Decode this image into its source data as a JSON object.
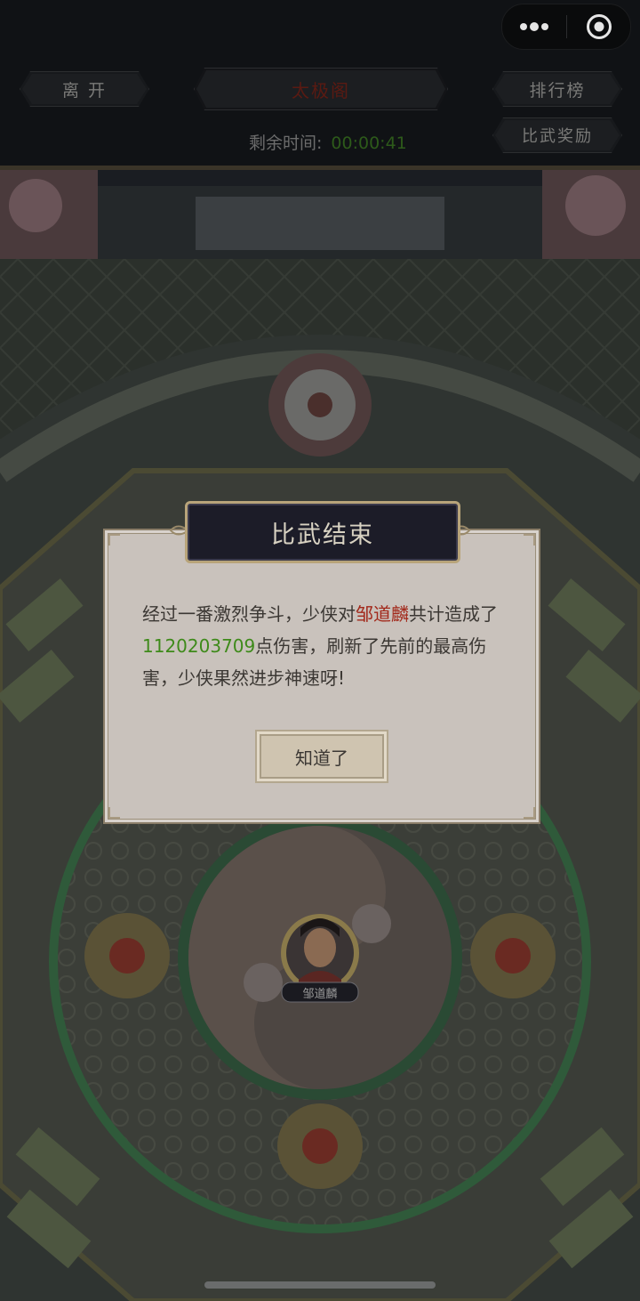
{
  "top_bar": {
    "leave_label": "离 开",
    "arena_title": "太极阁",
    "ranking_label": "排行榜",
    "reward_label": "比武奖励",
    "timer_label": "剩余时间:",
    "timer_value": "00:00:41"
  },
  "capsule": {
    "more_icon": "more-dots-icon",
    "close_icon": "target-circle-icon"
  },
  "scene": {
    "boss_name": "邹道麟"
  },
  "dialog": {
    "title": "比武结束",
    "text_part1": "经过一番激烈争斗，少侠对",
    "target_name": "邹道麟",
    "text_part2": "共计造成了",
    "damage": "1120203709",
    "text_part3": "点伤害，刷新了先前的最高伤害，少侠果然进步神速呀!",
    "ok_label": "知道了"
  },
  "colors": {
    "name_red": "#a2281a",
    "damage_green": "#3e8a1a"
  }
}
